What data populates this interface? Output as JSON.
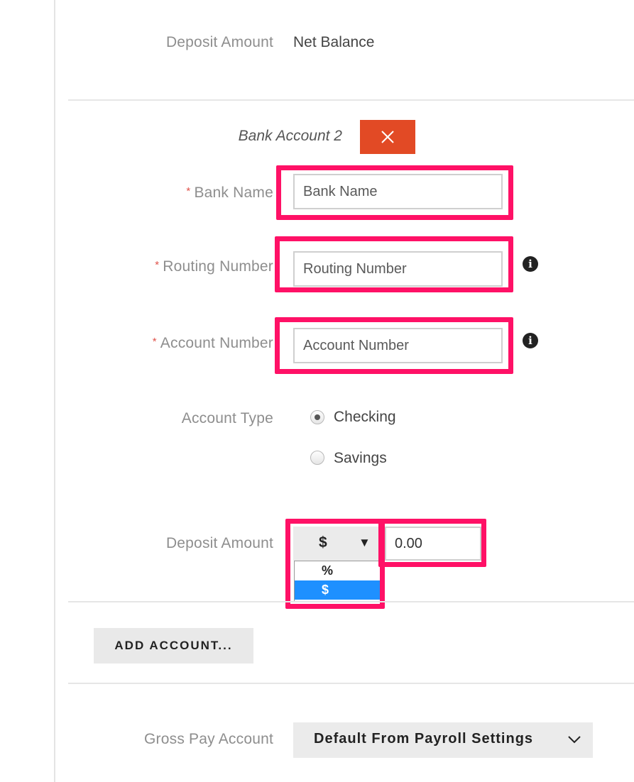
{
  "top_row": {
    "label": "Deposit Amount",
    "value": "Net Balance"
  },
  "bank_account": {
    "title": "Bank Account 2",
    "remove_icon": "close-icon",
    "required_marker": "*",
    "bank_name": {
      "label": "Bank Name",
      "placeholder": "Bank Name",
      "value": ""
    },
    "routing_number": {
      "label": "Routing Number",
      "placeholder": "Routing Number",
      "value": "",
      "info_icon": "info-icon",
      "info_glyph": "i"
    },
    "account_number": {
      "label": "Account Number",
      "placeholder": "Account Number",
      "value": "",
      "info_icon": "info-icon",
      "info_glyph": "i"
    },
    "account_type": {
      "label": "Account Type",
      "options": [
        {
          "label": "Checking",
          "checked": true
        },
        {
          "label": "Savings",
          "checked": false
        }
      ]
    },
    "deposit_amount": {
      "label": "Deposit Amount",
      "unit_selected": "$",
      "arrow": "▼",
      "unit_options": [
        {
          "label": "%",
          "selected": false
        },
        {
          "label": "$",
          "selected": true
        }
      ],
      "amount": "0.00"
    }
  },
  "add_account_button": "ADD ACCOUNT...",
  "gross_pay": {
    "label": "Gross Pay Account",
    "value": "Default From Payroll Settings",
    "icon": "chevron-down-icon"
  },
  "colors": {
    "highlight": "#ff1166",
    "remove_button": "#e24a25",
    "selected_option": "#1e90ff",
    "required": "#e0524a"
  }
}
